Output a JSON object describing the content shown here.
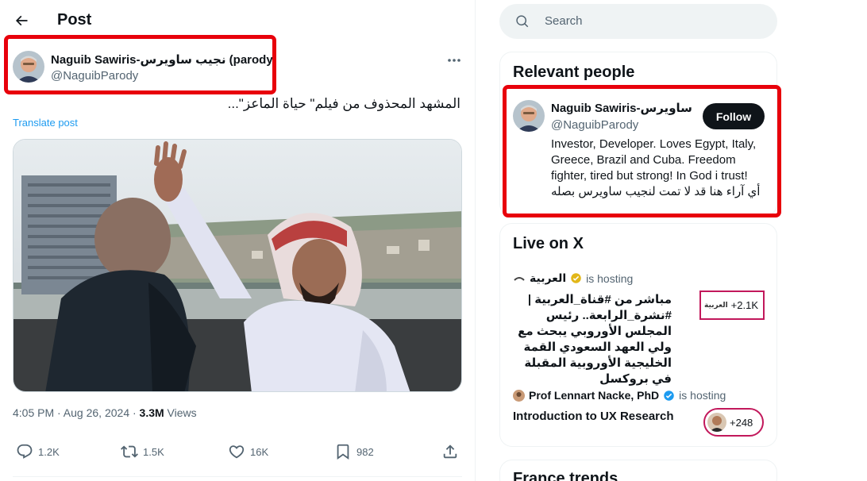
{
  "header": {
    "title": "Post"
  },
  "post": {
    "author_name": "Naguib Sawiris-نجيب ساويرس (parody)",
    "author_handle": "@NaguibParody",
    "text": "المشهد المحذوف من فيلم\" حياة الماعز\"...",
    "translate_label": "Translate post",
    "time": "4:05 PM · Aug 26, 2024 · ",
    "views_count": "3.3M",
    "views_label": " Views",
    "stats": {
      "replies": "1.2K",
      "reposts": "1.5K",
      "likes": "16K",
      "bookmarks": "982"
    }
  },
  "search": {
    "placeholder": "Search"
  },
  "relevant_people": {
    "title": "Relevant people",
    "name": "Naguib Sawiris-نجيب ساويرس",
    "handle": "@NaguibParody",
    "follow_label": "Follow",
    "bio": "Investor, Developer. Loves Egypt, Italy, Greece, Brazil and Cuba. Freedom fighter, tired but strong! In God i trust!",
    "bio_ar": "أي آراء هنا قد لا تمت لنجيب ساويرس بصله"
  },
  "live": {
    "title": "Live on X",
    "items": [
      {
        "host": "العربية",
        "hosting_label": "is hosting",
        "title": "مباشر من #قناة_العربية | #نشرة_الرابعة.. رئيس المجلس الأوروبي يبحث مع ولي العهد السعودي القمة الخليجية الأوروبية المقبلة في بروكسل",
        "count": "+2.1K",
        "logo_text": "العربية"
      },
      {
        "host": "Prof Lennart Nacke, PhD",
        "hosting_label": "is hosting",
        "title": "Introduction to UX Research",
        "count": "+248"
      }
    ]
  },
  "trends": {
    "title": "France trends"
  },
  "colors": {
    "highlight": "#e8000b",
    "accent": "#1d9bf0",
    "text": "#0f1419",
    "muted": "#536471"
  }
}
